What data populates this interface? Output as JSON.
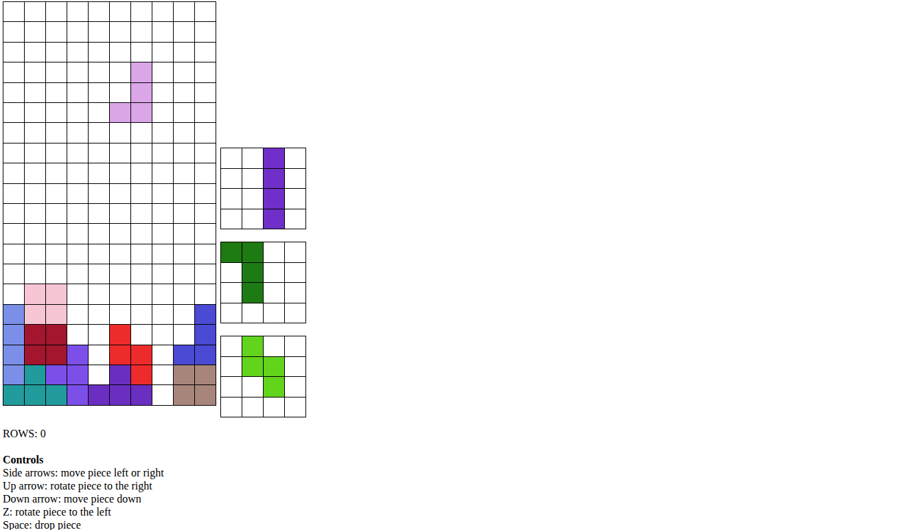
{
  "board": {
    "rows": [
      [
        "",
        "",
        "",
        "",
        "",
        "",
        "",
        "",
        "",
        ""
      ],
      [
        "",
        "",
        "",
        "",
        "",
        "",
        "",
        "",
        "",
        ""
      ],
      [
        "",
        "",
        "",
        "",
        "",
        "",
        "",
        "",
        "",
        ""
      ],
      [
        "",
        "",
        "",
        "",
        "",
        "",
        "#dba6e8",
        "",
        "",
        ""
      ],
      [
        "",
        "",
        "",
        "",
        "",
        "",
        "#dba6e8",
        "",
        "",
        ""
      ],
      [
        "",
        "",
        "",
        "",
        "",
        "#dba6e8",
        "#dba6e8",
        "",
        "",
        ""
      ],
      [
        "",
        "",
        "",
        "",
        "",
        "",
        "",
        "",
        "",
        ""
      ],
      [
        "",
        "",
        "",
        "",
        "",
        "",
        "",
        "",
        "",
        ""
      ],
      [
        "",
        "",
        "",
        "",
        "",
        "",
        "",
        "",
        "",
        ""
      ],
      [
        "",
        "",
        "",
        "",
        "",
        "",
        "",
        "",
        "",
        ""
      ],
      [
        "",
        "",
        "",
        "",
        "",
        "",
        "",
        "",
        "",
        ""
      ],
      [
        "",
        "",
        "",
        "",
        "",
        "",
        "",
        "",
        "",
        ""
      ],
      [
        "",
        "",
        "",
        "",
        "",
        "",
        "",
        "",
        "",
        ""
      ],
      [
        "",
        "",
        "",
        "",
        "",
        "",
        "",
        "",
        "",
        ""
      ],
      [
        "",
        "#f7c6d4",
        "#f7c6d4",
        "",
        "",
        "",
        "",
        "",
        "",
        ""
      ],
      [
        "#7b8fe8",
        "#f7c6d4",
        "#f7c6d4",
        "",
        "",
        "",
        "",
        "",
        "",
        "#4a4ad4"
      ],
      [
        "#7b8fe8",
        "#a3162e",
        "#a3162e",
        "",
        "",
        "#ee2b2b",
        "",
        "",
        "",
        "#4a4ad4"
      ],
      [
        "#7b8fe8",
        "#a3162e",
        "#a3162e",
        "#7b4fe8",
        "",
        "#ee2b2b",
        "#ee2b2b",
        "",
        "#4a4ad4",
        "#4a4ad4"
      ],
      [
        "#7b8fe8",
        "#219b9b",
        "#7b4fe8",
        "#7b4fe8",
        "",
        "#6a2fc0",
        "#ee2b2b",
        "",
        "#a8857a",
        "#a8857a"
      ],
      [
        "#219b9b",
        "#219b9b",
        "#219b9b",
        "#7b4fe8",
        "#6a2fc0",
        "#6a2fc0",
        "#6a2fc0",
        "",
        "#a8857a",
        "#a8857a"
      ]
    ]
  },
  "next_pieces": [
    {
      "color": "#6f2fc8",
      "cells": [
        [
          0,
          2
        ],
        [
          1,
          2
        ],
        [
          2,
          2
        ],
        [
          3,
          2
        ]
      ]
    },
    {
      "color": "#1e7a12",
      "cells": [
        [
          0,
          0
        ],
        [
          0,
          1
        ],
        [
          1,
          1
        ],
        [
          2,
          1
        ]
      ]
    },
    {
      "color": "#62d41c",
      "cells": [
        [
          0,
          1
        ],
        [
          1,
          1
        ],
        [
          1,
          2
        ],
        [
          2,
          2
        ]
      ]
    }
  ],
  "rows_label": "ROWS: 0",
  "controls": {
    "title": "Controls",
    "items": [
      "Side arrows: move piece left or right",
      "Up arrow: rotate piece to the right",
      "Down arrow: move piece down",
      "Z: rotate piece to the left",
      "Space: drop piece"
    ]
  }
}
